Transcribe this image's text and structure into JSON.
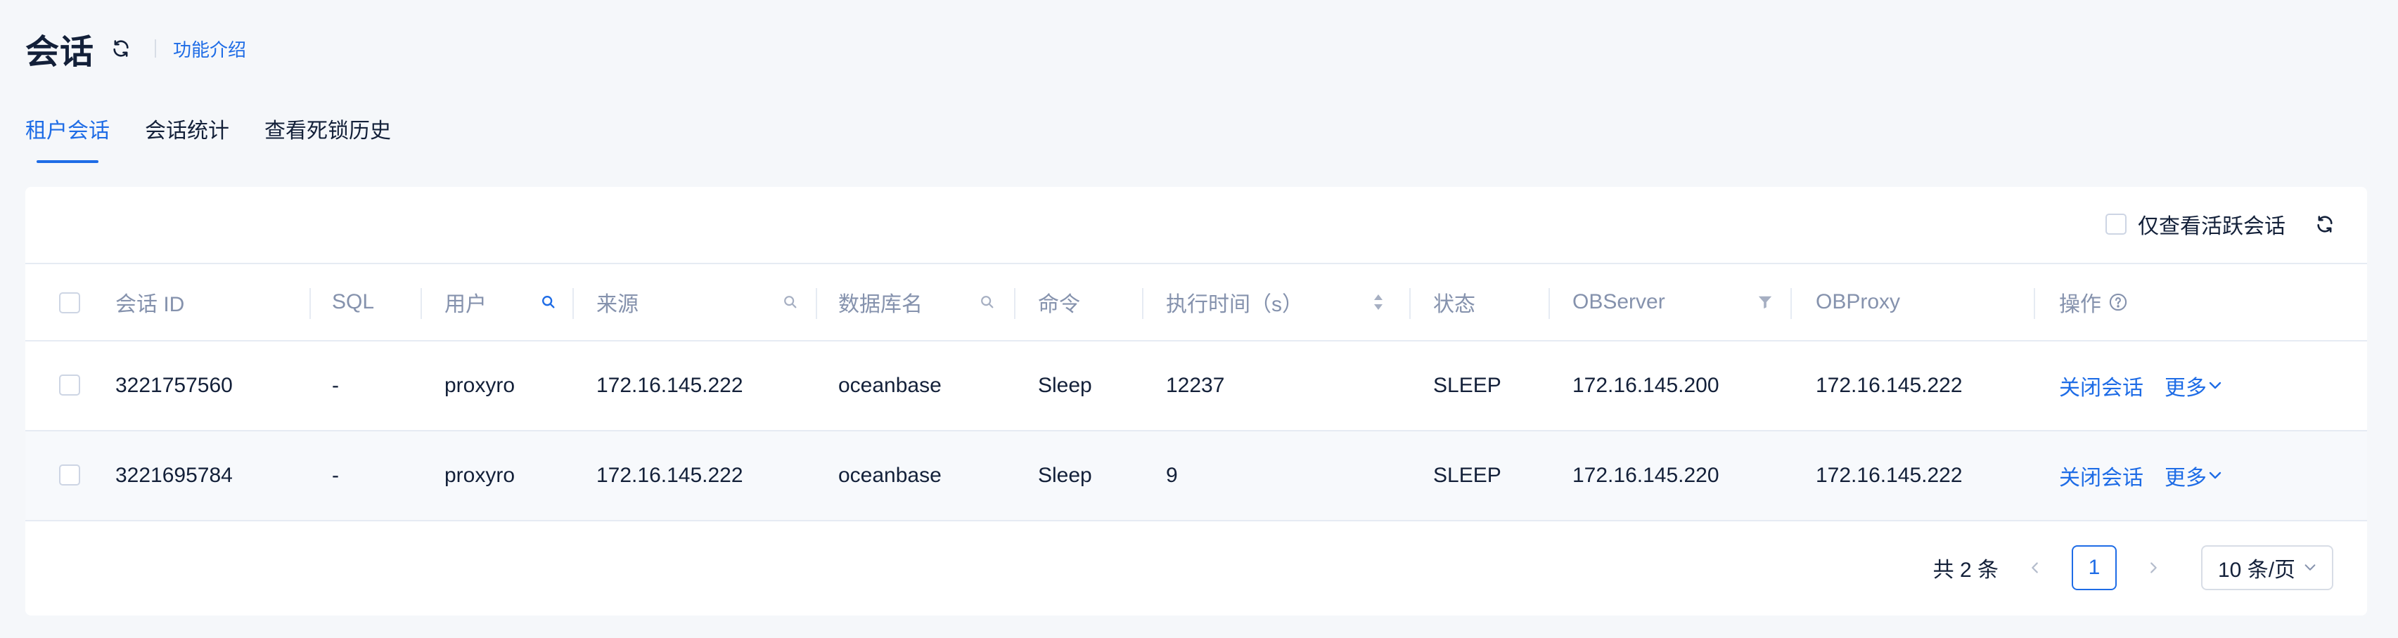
{
  "header": {
    "title": "会话",
    "intro_link": "功能介绍"
  },
  "tabs": [
    {
      "label": "租户会话",
      "active": true
    },
    {
      "label": "会话统计",
      "active": false
    },
    {
      "label": "查看死锁历史",
      "active": false
    }
  ],
  "toolbar": {
    "active_only_label": "仅查看活跃会话"
  },
  "table": {
    "columns": [
      "会话 ID",
      "SQL",
      "用户",
      "来源",
      "数据库名",
      "命令",
      "执行时间（s）",
      "状态",
      "OBServer",
      "OBProxy",
      "操作"
    ],
    "rows": [
      {
        "session_id": "3221757560",
        "sql": "-",
        "user": "proxyro",
        "source": "172.16.145.222",
        "database": "oceanbase",
        "command": "Sleep",
        "exec_time": "12237",
        "state": "SLEEP",
        "observer": "172.16.145.200",
        "obproxy": "172.16.145.222",
        "close_label": "关闭会话",
        "more_label": "更多"
      },
      {
        "session_id": "3221695784",
        "sql": "-",
        "user": "proxyro",
        "source": "172.16.145.222",
        "database": "oceanbase",
        "command": "Sleep",
        "exec_time": "9",
        "state": "SLEEP",
        "observer": "172.16.145.220",
        "obproxy": "172.16.145.222",
        "close_label": "关闭会话",
        "more_label": "更多"
      }
    ]
  },
  "pagination": {
    "total": "共 2 条",
    "current_page": "1",
    "page_size": "10 条/页"
  },
  "colors": {
    "accent": "#1e6ce6",
    "text": "#132039",
    "muted": "#8592ad",
    "border": "#e6ebf3",
    "background": "#f5f7fa"
  },
  "icons": [
    "refresh-icon",
    "search-icon",
    "sort-icon",
    "filter-icon",
    "help-icon",
    "chevron-down-icon",
    "chevron-left-icon",
    "chevron-right-icon"
  ]
}
